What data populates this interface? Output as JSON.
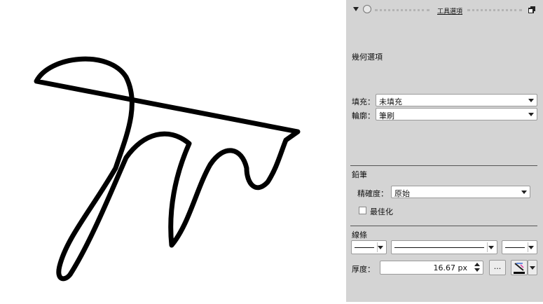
{
  "panel": {
    "title": "工具選項",
    "header_icon": "pin-icon",
    "geometry_title": "幾何選項",
    "fill": {
      "label": "填充：",
      "value": "未填充"
    },
    "stroke": {
      "label": "輪廓：",
      "value": "筆刷"
    },
    "pencil": {
      "title": "鉛筆",
      "precision_label": "精確度：",
      "precision_value": "原始",
      "optimize_label": "最佳化",
      "optimize_checked": false
    },
    "lines": {
      "title": "線條",
      "thickness_label": "厚度：",
      "thickness_value": "16.67 px",
      "more_button": "..."
    }
  },
  "colors": {
    "panel_bg": "#d4d4d4",
    "stroke": "#000000"
  }
}
